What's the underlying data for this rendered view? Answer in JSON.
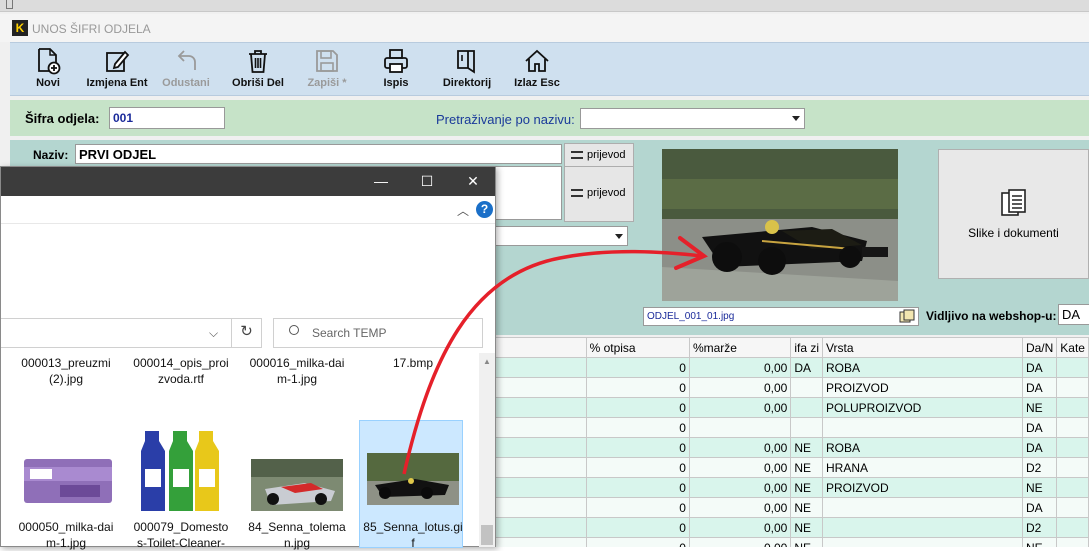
{
  "app": {
    "title": "UNOS ŠIFRI ODJELA"
  },
  "toolbar": [
    {
      "label": "Novi",
      "icon": "new-document-icon",
      "disabled": false
    },
    {
      "label": "Izmjena Ent",
      "icon": "edit-icon",
      "disabled": false
    },
    {
      "label": "Odustani",
      "icon": "undo-icon",
      "disabled": true
    },
    {
      "label": "Obriši Del",
      "icon": "trash-icon",
      "disabled": false
    },
    {
      "label": "Zapiši *",
      "icon": "save-icon",
      "disabled": true
    },
    {
      "label": "Ispis",
      "icon": "printer-icon",
      "disabled": false
    },
    {
      "label": "Direktorij",
      "icon": "directory-icon",
      "disabled": false
    },
    {
      "label": "Izlaz Esc",
      "icon": "home-icon",
      "disabled": false
    }
  ],
  "form": {
    "sifra_label": "Šifra odjela:",
    "sifra_value": "001",
    "search_label": "Pretraživanje po nazivu:",
    "naziv_label": "Naziv:",
    "naziv_value": "PRVI ODJEL",
    "prijevod_label": "prijevod",
    "file_name": "ODJEL_001_01.jpg",
    "slike_button": "Slike i dokumenti",
    "webshop_label": "Vidljivo na webshop-u:",
    "webshop_value": "DA"
  },
  "grid": {
    "headers": [
      "% otpisa",
      "%marže",
      "ifa zi",
      "Vrsta",
      "Da/N",
      "Kate"
    ],
    "rows": [
      [
        "0",
        "0,00",
        "DA",
        "ROBA",
        "DA"
      ],
      [
        "0",
        "0,00",
        "",
        "PROIZVOD",
        "DA"
      ],
      [
        "0",
        "0,00",
        "",
        "POLUPROIZVOD",
        "NE"
      ],
      [
        "0",
        "",
        "",
        "",
        "DA"
      ],
      [
        "0",
        "0,00",
        "NE",
        "ROBA",
        "DA"
      ],
      [
        "0",
        "0,00",
        "NE",
        "HRANA",
        "D2"
      ],
      [
        "0",
        "0,00",
        "NE",
        "PROIZVOD",
        "NE"
      ],
      [
        "0",
        "0,00",
        "NE",
        "",
        "DA"
      ],
      [
        "0",
        "0,00",
        "NE",
        "",
        "D2"
      ],
      [
        "0",
        "0,00",
        "NE",
        "",
        "NE"
      ]
    ]
  },
  "explorer": {
    "window_controls": {
      "minimize": "—",
      "maximize": "☐",
      "close": "✕"
    },
    "help": "?",
    "search_placeholder": "Search TEMP",
    "files": [
      {
        "name": "000013_preuzmi (2).jpg"
      },
      {
        "name": "000014_opis_proizvoda.rtf"
      },
      {
        "name": "000016_milka-daim-1.jpg"
      },
      {
        "name": "17.bmp"
      },
      {
        "name": "000050_milka-daim-1.jpg"
      },
      {
        "name": "000079_Domestos-Toilet-Cleaner-"
      },
      {
        "name": "84_Senna_toleman.jpg"
      },
      {
        "name": "85_Senna_lotus.gif"
      }
    ]
  },
  "colors": {
    "toolbar": "#cfe0ef",
    "green_row": "#c6e3c8",
    "teal_panel": "#b4d6d0",
    "grid_row": "#d9f5ec",
    "arrow": "#e5202a"
  }
}
